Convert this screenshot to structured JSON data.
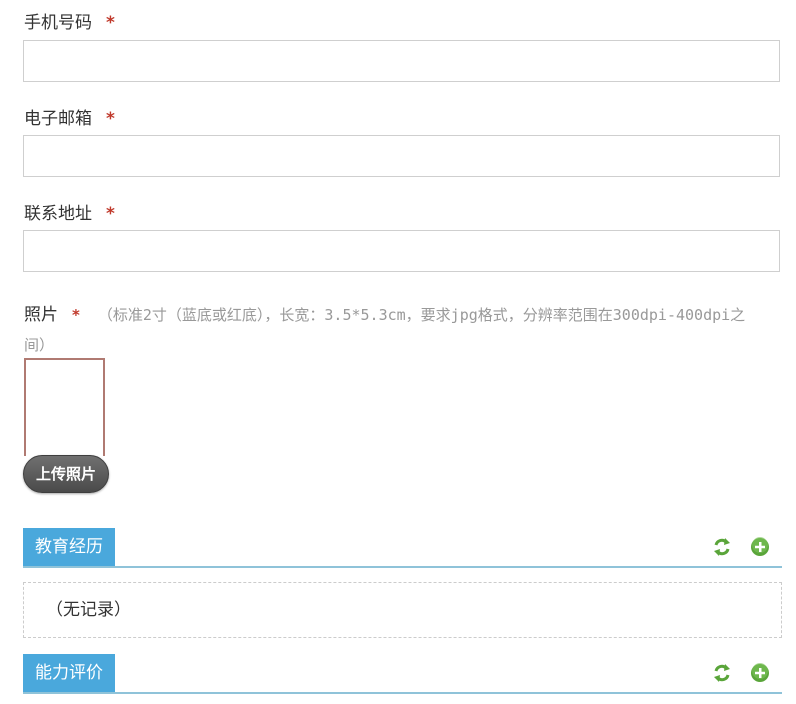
{
  "form": {
    "phone": {
      "label": "手机号码",
      "required_mark": "*",
      "value": ""
    },
    "email": {
      "label": "电子邮箱",
      "required_mark": "*",
      "value": ""
    },
    "address": {
      "label": "联系地址",
      "required_mark": "*",
      "value": ""
    },
    "photo": {
      "label": "照片",
      "required_mark": "*",
      "hint": "（标准2寸（蓝底或红底），长宽：3.5*5.3cm，要求jpg格式，分辨率范围在300dpi-400dpi之间）",
      "upload_button": "上传照片"
    }
  },
  "sections": [
    {
      "title": "教育经历",
      "refresh_icon": "refresh-icon",
      "add_icon": "add-icon"
    },
    {
      "title": "能力评价",
      "refresh_icon": "refresh-icon",
      "add_icon": "add-icon"
    }
  ],
  "education_records": {
    "empty_text": "（无记录）"
  },
  "colors": {
    "required": "#c0392b",
    "section_tab": "#4aa8dc",
    "section_line": "#8fc3d9",
    "icon_green": "#5aa53a",
    "hint_text": "#999999"
  }
}
